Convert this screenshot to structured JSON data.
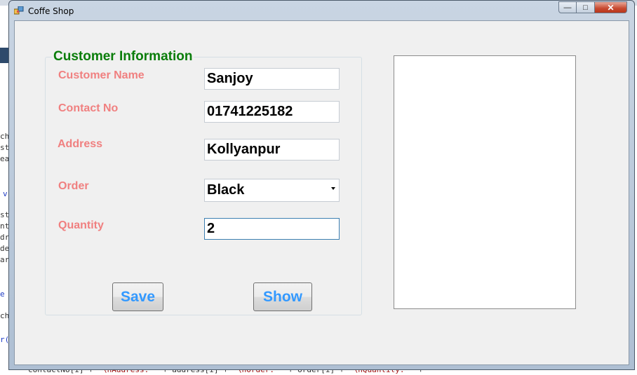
{
  "window": {
    "title": "Coffe Shop",
    "controls": {
      "minimize": "—",
      "maximize": "□",
      "close": "✕"
    }
  },
  "form": {
    "group_title": "Customer Information",
    "labels": {
      "customer_name": "Customer Name",
      "contact_no": "Contact No",
      "address": "Address",
      "order": "Order",
      "quantity": "Quantity"
    },
    "values": {
      "customer_name": "Sanjoy",
      "contact_no": "01741225182",
      "address": "Kollyanpur",
      "order": "Black",
      "quantity": "2"
    },
    "buttons": {
      "save": "Save",
      "show": "Show"
    }
  },
  "background": {
    "left_fragments": [
      "ch",
      "st",
      "ea",
      "v",
      "st",
      "nt",
      "dr",
      "de",
      "ar",
      "e",
      "ch",
      "r("
    ],
    "bottom_line": {
      "a": "contactNo[i] + ",
      "b": "\"\\nAddress: \"",
      "c": " + address[i] + ",
      "d": "\"\\nOrder: \"",
      "e": " + order[i] + ",
      "f": "\"\\nQuantity: \"",
      "g": " +"
    }
  },
  "colors": {
    "label": "#f08080",
    "group_title": "#0a7d0a",
    "button_text": "#3399ff"
  }
}
